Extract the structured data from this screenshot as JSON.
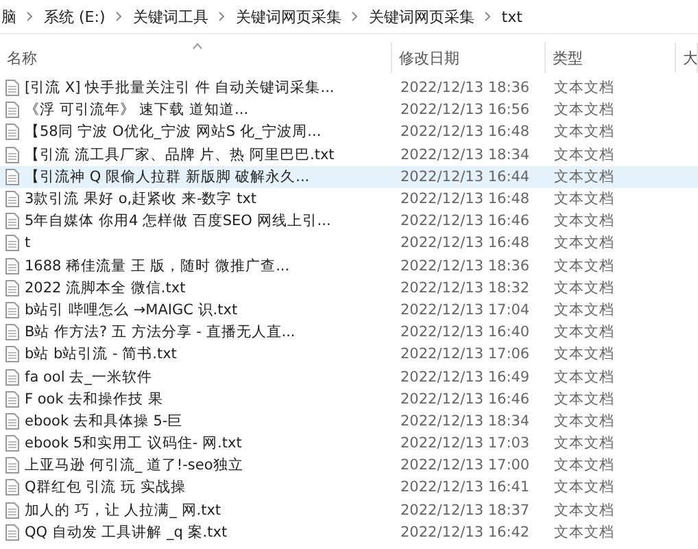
{
  "breadcrumb": [
    "脑",
    "系统 (E:)",
    "关键词工具",
    "关键词网页采集",
    "关键词网页采集",
    "txt"
  ],
  "columns": [
    "名称",
    "修改日期",
    "类型",
    "大"
  ],
  "files": [
    {
      "name": "[引流 X] 快手批量关注引 件 自动关键词采集...",
      "modified": "2022/12/13 18:36",
      "type": "文本文档",
      "selected": false
    },
    {
      "name": "《浮 可引流年》 速下载 道知道...",
      "modified": "2022/12/13 16:56",
      "type": "文本文档",
      "selected": false
    },
    {
      "name": "【58同 宁波 O优化_宁波 网站S 化_宁波周...",
      "modified": "2022/12/13 16:48",
      "type": "文本文档",
      "selected": false
    },
    {
      "name": "【引流 流工具厂家、品牌 片、热 阿里巴巴.txt",
      "modified": "2022/12/13 18:34",
      "type": "文本文档",
      "selected": false
    },
    {
      "name": "【引流神 Q 限偷人拉群 新版脚 破解永久...",
      "modified": "2022/12/13 16:44",
      "type": "文本文档",
      "selected": true
    },
    {
      "name": "3款引流 果好 o,赶紧收 来-数字 txt",
      "modified": "2022/12/13 16:48",
      "type": "文本文档",
      "selected": false
    },
    {
      "name": "5年自媒体 你用4 怎样做 百度SEO 网线上引...",
      "modified": "2022/12/13 16:46",
      "type": "文本文档",
      "selected": false
    },
    {
      "name": "t",
      "modified": "2022/12/13 16:48",
      "type": "文本文档",
      "selected": false
    },
    {
      "name": "1688 稀佳流量 王 版，随时 微推广查...",
      "modified": "2022/12/13 18:36",
      "type": "文本文档",
      "selected": false
    },
    {
      "name": "2022 流脚本全 微信.txt",
      "modified": "2022/12/13 18:32",
      "type": "文本文档",
      "selected": false
    },
    {
      "name": "b站引 哔哩怎么 →MAIGC 识.txt",
      "modified": "2022/12/13 17:04",
      "type": "文本文档",
      "selected": false
    },
    {
      "name": "B站 作方法? 五 方法分享 - 直播无人直...",
      "modified": "2022/12/13 16:40",
      "type": "文本文档",
      "selected": false
    },
    {
      "name": "b站 b站引流 - 简书.txt",
      "modified": "2022/12/13 17:06",
      "type": "文本文档",
      "selected": false
    },
    {
      "name": "fa ool 去_一米软件",
      "modified": "2022/12/13 16:49",
      "type": "文本文档",
      "selected": false
    },
    {
      "name": "F ook 去和操作技 果",
      "modified": "2022/12/13 16:46",
      "type": "文本文档",
      "selected": false
    },
    {
      "name": "ebook 去和具体操 5-巨",
      "modified": "2022/12/13 18:34",
      "type": "文本文档",
      "selected": false
    },
    {
      "name": "ebook 5和实用工 议码住- 网.txt",
      "modified": "2022/12/13 17:03",
      "type": "文本文档",
      "selected": false
    },
    {
      "name": "上亚马逊 何引流_ 道了!-seo独立",
      "modified": "2022/12/13 17:00",
      "type": "文本文档",
      "selected": false
    },
    {
      "name": "Q群红包 引流 玩 实战操",
      "modified": "2022/12/13 16:41",
      "type": "文本文档",
      "selected": false
    },
    {
      "name": "加人的 巧，让 人拉满_ 网.txt",
      "modified": "2022/12/13 18:37",
      "type": "文本文档",
      "selected": false
    },
    {
      "name": "QQ 自动发 工具讲解 _q 案.txt",
      "modified": "2022/12/13 16:42",
      "type": "文本文档",
      "selected": false
    }
  ]
}
